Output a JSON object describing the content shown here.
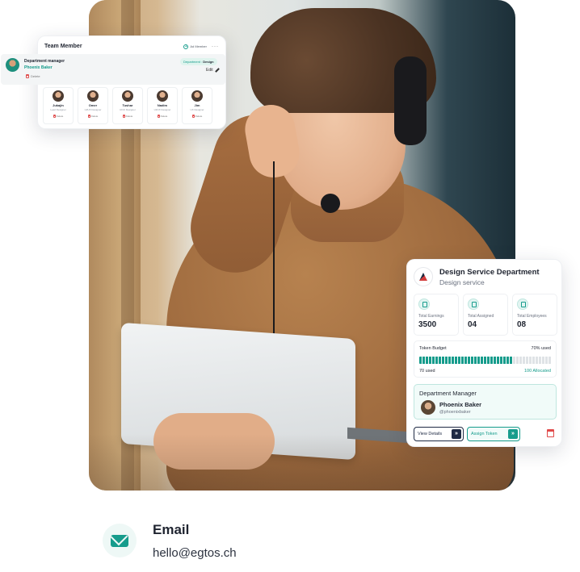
{
  "team_card": {
    "title": "Team Member",
    "add_label": "Ad Member",
    "more_label": "···",
    "manager": {
      "role": "Department manager",
      "name": "Phoenix Baker",
      "delete_label": "Delete",
      "tag_prefix": "Department : ",
      "tag_value": "Design",
      "edit_label": "Edit"
    },
    "members": [
      {
        "name": "Jukajin",
        "role": "Lead Designer",
        "delete_label": "Delete"
      },
      {
        "name": "Omer",
        "role": "UI/UX Designer",
        "delete_label": "Delete"
      },
      {
        "name": "Tushar",
        "role": "UI/UI Designer",
        "delete_label": "Delete"
      },
      {
        "name": "Nadim",
        "role": "UI/UX Designer",
        "delete_label": "Delete"
      },
      {
        "name": "Jim",
        "role": "UX Designer",
        "delete_label": "Delete"
      }
    ]
  },
  "dept_card": {
    "title": "Design Service Department",
    "subtitle": "Design service",
    "stats": [
      {
        "label": "Total Earnings",
        "value": "3500",
        "icon": "coin-icon"
      },
      {
        "label": "Total Assigned",
        "value": "04",
        "icon": "stack-icon"
      },
      {
        "label": "Total Employees",
        "value": "08",
        "icon": "people-icon"
      }
    ],
    "budget": {
      "label": "Token Budget",
      "percent_label": "70% used",
      "fraction_used": 0.7,
      "used_label": "70 used",
      "allocated_label": "100 Allocated"
    },
    "manager": {
      "heading": "Department Manager",
      "name": "Phoenix Baker",
      "handle": "@phoenixbaker"
    },
    "view_label": "View Details",
    "assign_label": "Assign Token"
  },
  "contact": {
    "label": "Email",
    "value": "hello@egtos.ch"
  },
  "colors": {
    "accent": "#169c8c",
    "navy": "#1f2a44",
    "danger": "#e04848"
  }
}
